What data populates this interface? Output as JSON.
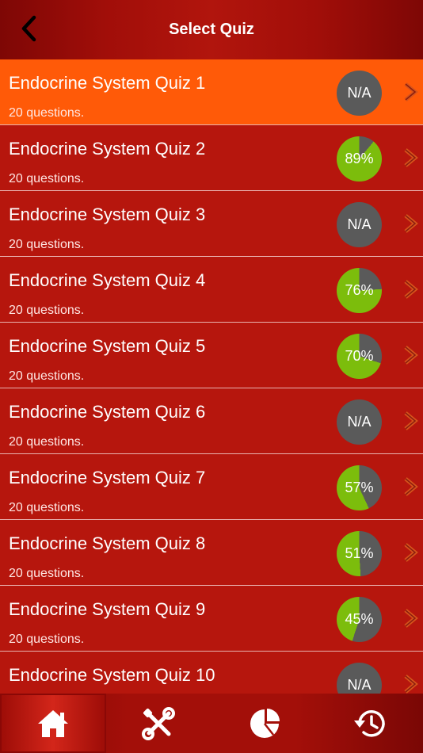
{
  "header": {
    "title": "Select Quiz"
  },
  "colors": {
    "selected_row": "#ff5a08",
    "row": "#b6160d",
    "score_green": "#7cbd0c",
    "score_gray": "#5a5a5a"
  },
  "quizzes": [
    {
      "title": "Endocrine System Quiz 1",
      "subtitle": "20 questions.",
      "score_label": "N/A",
      "score": null,
      "selected": true
    },
    {
      "title": "Endocrine System Quiz 2",
      "subtitle": "20 questions.",
      "score_label": "89%",
      "score": 89,
      "selected": false
    },
    {
      "title": "Endocrine System Quiz 3",
      "subtitle": "20 questions.",
      "score_label": "N/A",
      "score": null,
      "selected": false
    },
    {
      "title": "Endocrine System Quiz 4",
      "subtitle": "20 questions.",
      "score_label": "76%",
      "score": 76,
      "selected": false
    },
    {
      "title": "Endocrine System Quiz 5",
      "subtitle": "20 questions.",
      "score_label": "70%",
      "score": 70,
      "selected": false
    },
    {
      "title": "Endocrine System Quiz 6",
      "subtitle": "20 questions.",
      "score_label": "N/A",
      "score": null,
      "selected": false
    },
    {
      "title": "Endocrine System Quiz 7",
      "subtitle": "20 questions.",
      "score_label": "57%",
      "score": 57,
      "selected": false
    },
    {
      "title": "Endocrine System Quiz 8",
      "subtitle": "20 questions.",
      "score_label": "51%",
      "score": 51,
      "selected": false
    },
    {
      "title": "Endocrine System Quiz 9",
      "subtitle": "20 questions.",
      "score_label": "45%",
      "score": 45,
      "selected": false
    },
    {
      "title": "Endocrine System Quiz 10",
      "subtitle": "",
      "score_label": "N/A",
      "score": null,
      "selected": false
    }
  ],
  "tabbar": {
    "tabs": [
      {
        "icon": "home-icon",
        "active": true
      },
      {
        "icon": "tools-icon",
        "active": false
      },
      {
        "icon": "pie-chart-icon",
        "active": false
      },
      {
        "icon": "history-icon",
        "active": false
      }
    ]
  }
}
